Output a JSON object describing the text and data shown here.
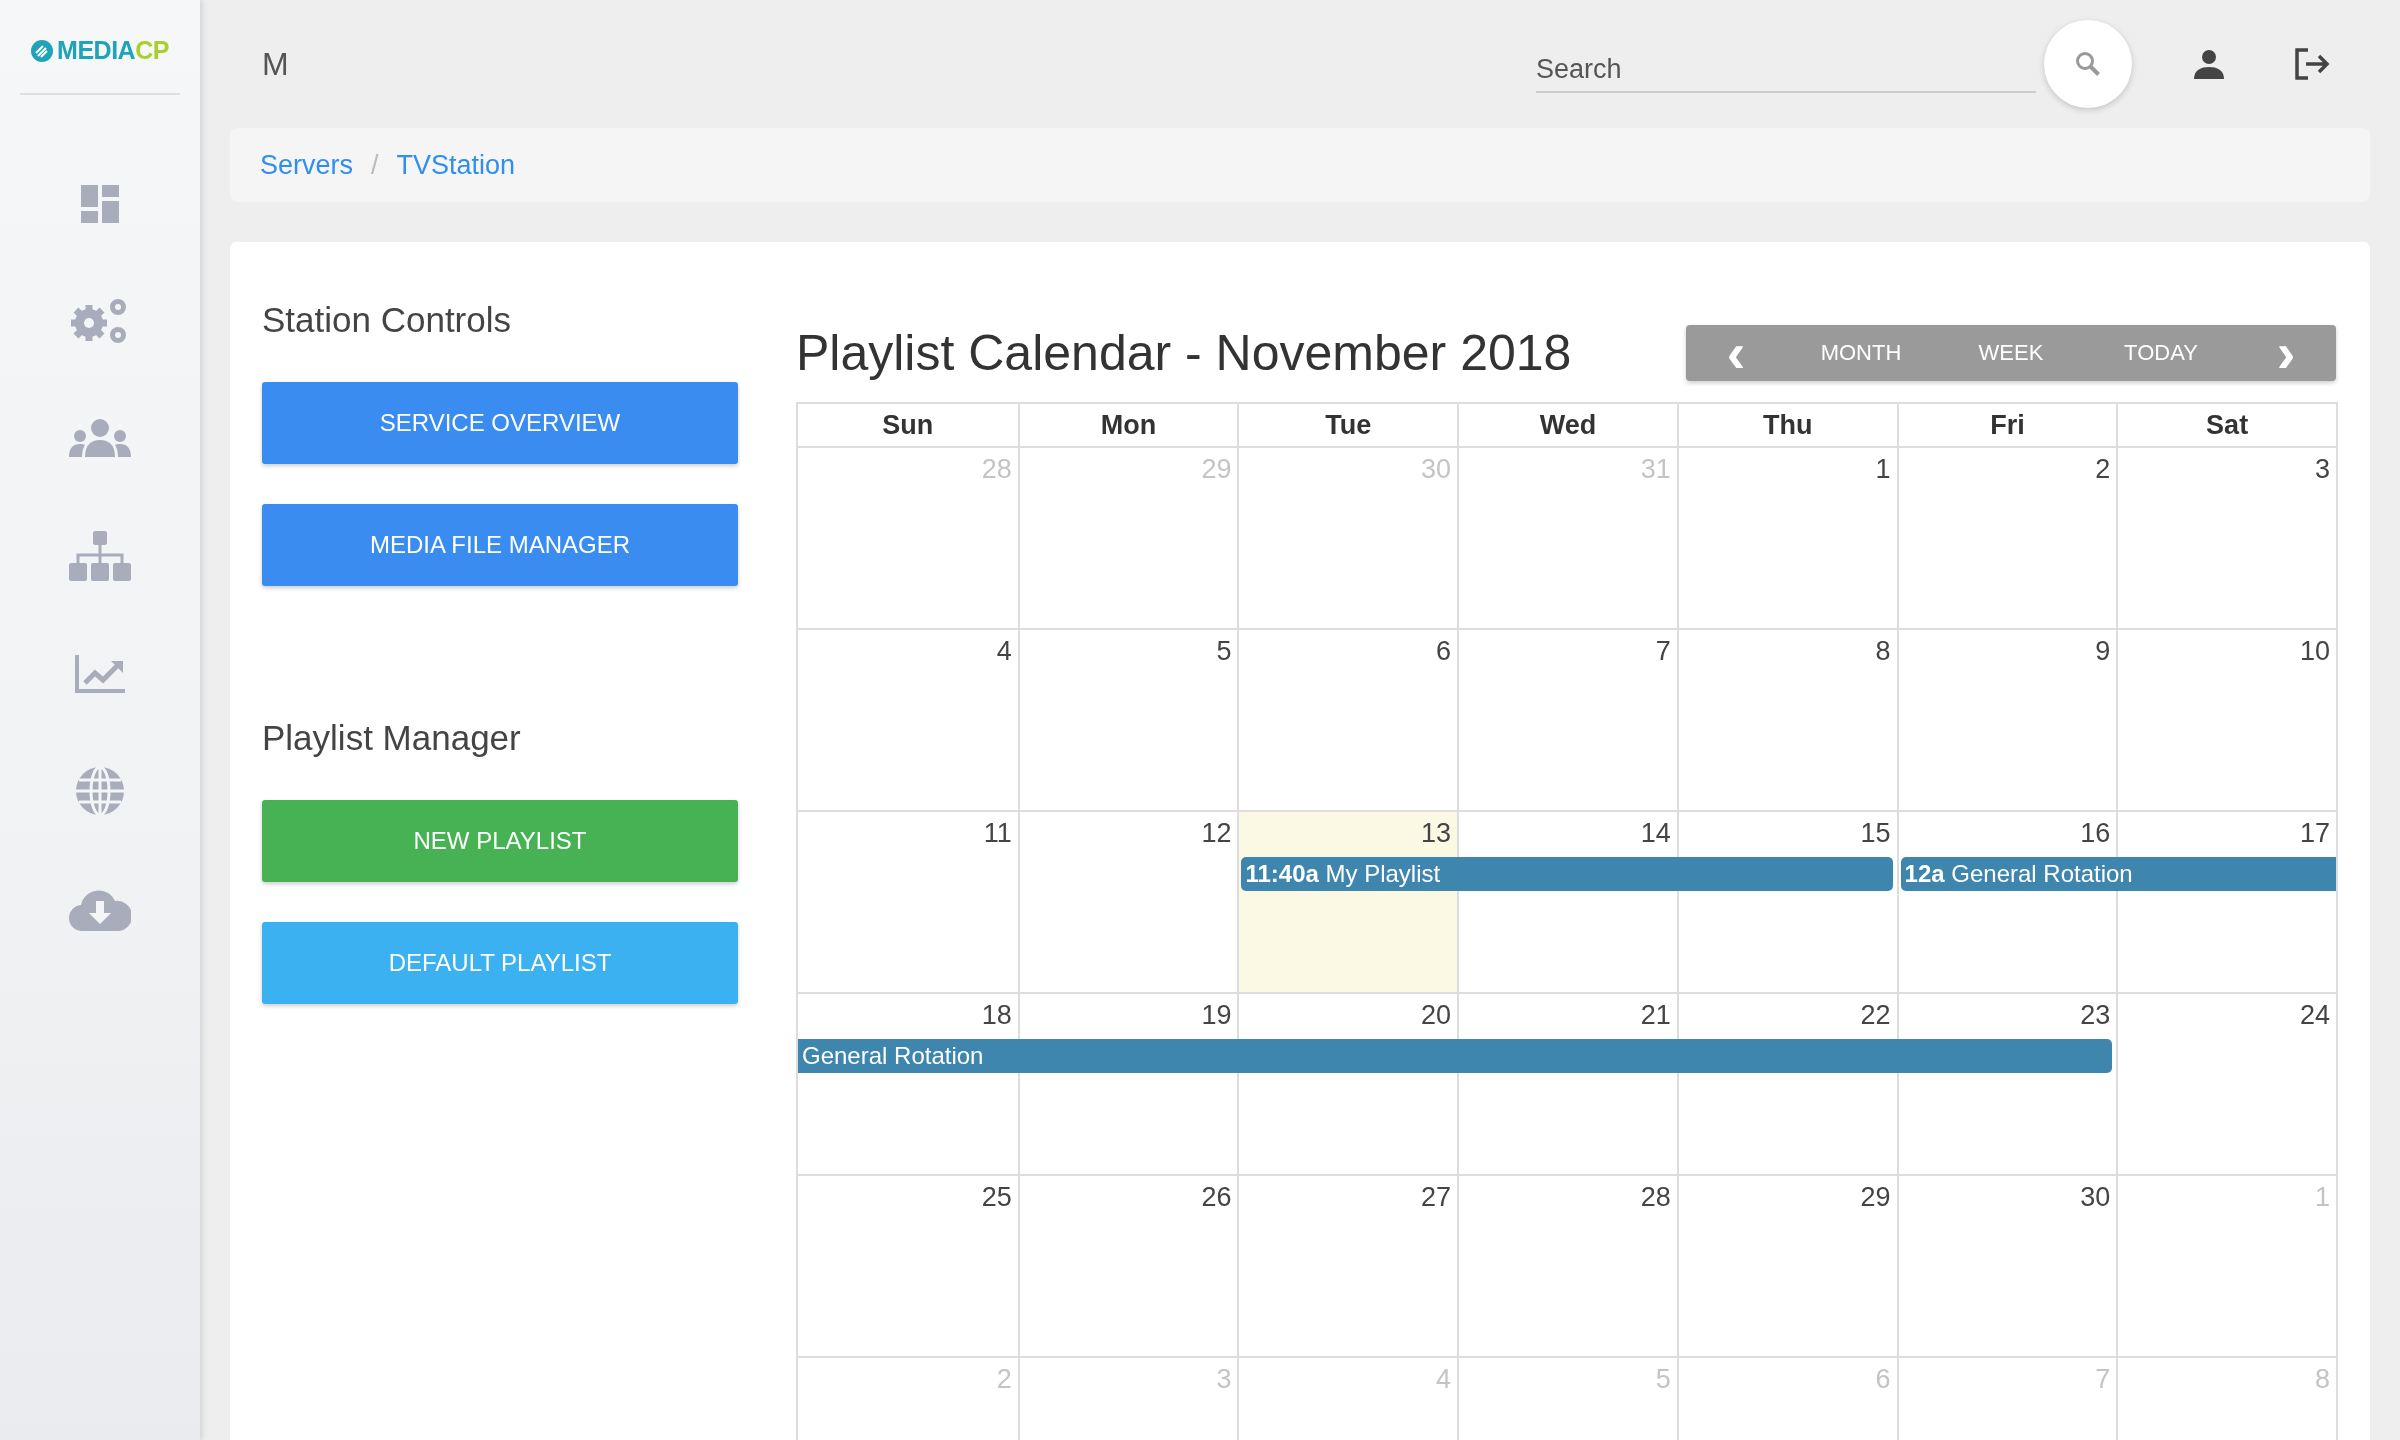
{
  "sidebar": {
    "brand": "MEDIA",
    "brand_accent": "CP"
  },
  "top_bar": {
    "title": "M",
    "search": {
      "placeholder": "Search"
    }
  },
  "breadcrumb": {
    "items": [
      "Servers",
      "TVStation"
    ],
    "separator": "/"
  },
  "panels": [
    {
      "title": "Station Controls",
      "buttons": [
        {
          "label": "SERVICE OVERVIEW",
          "kind": "primary"
        },
        {
          "label": "MEDIA FILE MANAGER",
          "kind": "primary"
        }
      ]
    },
    {
      "title": "Playlist Manager",
      "buttons": [
        {
          "label": "NEW PLAYLIST",
          "kind": "success"
        },
        {
          "label": "DEFAULT PLAYLIST",
          "kind": "info"
        }
      ]
    }
  ],
  "calendar": {
    "title": "Playlist Calendar - November 2018",
    "nav": {
      "prev": "‹",
      "next": "›",
      "buttons": [
        "MONTH",
        "WEEK",
        "TODAY"
      ]
    },
    "weekdays": [
      "Sun",
      "Mon",
      "Tue",
      "Wed",
      "Thu",
      "Fri",
      "Sat"
    ],
    "weeks": [
      {
        "days": [
          {
            "day": "28",
            "other_month": true,
            "today": false
          },
          {
            "day": "29",
            "other_month": true,
            "today": false
          },
          {
            "day": "30",
            "other_month": true,
            "today": false
          },
          {
            "day": "31",
            "other_month": true,
            "today": false
          },
          {
            "day": "1",
            "other_month": false,
            "today": false
          },
          {
            "day": "2",
            "other_month": false,
            "today": false
          },
          {
            "day": "3",
            "other_month": false,
            "today": false
          }
        ]
      },
      {
        "days": [
          {
            "day": "4",
            "other_month": false,
            "today": false
          },
          {
            "day": "5",
            "other_month": false,
            "today": false
          },
          {
            "day": "6",
            "other_month": false,
            "today": false
          },
          {
            "day": "7",
            "other_month": false,
            "today": false
          },
          {
            "day": "8",
            "other_month": false,
            "today": false
          },
          {
            "day": "9",
            "other_month": false,
            "today": false
          },
          {
            "day": "10",
            "other_month": false,
            "today": false
          }
        ]
      },
      {
        "days": [
          {
            "day": "11",
            "other_month": false,
            "today": false
          },
          {
            "day": "12",
            "other_month": false,
            "today": false
          },
          {
            "day": "13",
            "other_month": false,
            "today": true,
            "has_event": true,
            "event": {
              "time": "11:40a",
              "title": "My Playlist",
              "continues_before": false,
              "continues_after": false
            }
          },
          {
            "day": "14",
            "other_month": false,
            "today": false,
            "has_event": true
          },
          {
            "day": "15",
            "other_month": false,
            "today": false,
            "has_event": true
          },
          {
            "day": "16",
            "other_month": false,
            "today": false,
            "has_event": true,
            "event": {
              "time": "12a",
              "title": "General Rotation",
              "continues_before": false,
              "continues_after": true
            }
          },
          {
            "day": "17",
            "other_month": false,
            "today": false,
            "has_event": true
          }
        ]
      },
      {
        "days": [
          {
            "day": "18",
            "other_month": false,
            "today": false,
            "has_event": true,
            "event": {
              "title": "General Rotation",
              "continues_before": true,
              "continues_after": false
            }
          },
          {
            "day": "19",
            "other_month": false,
            "today": false,
            "has_event": true
          },
          {
            "day": "20",
            "other_month": false,
            "today": false,
            "has_event": true
          },
          {
            "day": "21",
            "other_month": false,
            "today": false,
            "has_event": true
          },
          {
            "day": "22",
            "other_month": false,
            "today": false,
            "has_event": true
          },
          {
            "day": "23",
            "other_month": false,
            "today": false,
            "has_event": true
          },
          {
            "day": "24",
            "other_month": false,
            "today": false
          }
        ]
      },
      {
        "days": [
          {
            "day": "25",
            "other_month": false,
            "today": false
          },
          {
            "day": "26",
            "other_month": false,
            "today": false
          },
          {
            "day": "27",
            "other_month": false,
            "today": false
          },
          {
            "day": "28",
            "other_month": false,
            "today": false
          },
          {
            "day": "29",
            "other_month": false,
            "today": false
          },
          {
            "day": "30",
            "other_month": false,
            "today": false
          },
          {
            "day": "1",
            "other_month": true,
            "today": false
          }
        ]
      },
      {
        "days": [
          {
            "day": "2",
            "other_month": true,
            "today": false
          },
          {
            "day": "3",
            "other_month": true,
            "today": false
          },
          {
            "day": "4",
            "other_month": true,
            "today": false
          },
          {
            "day": "5",
            "other_month": true,
            "today": false
          },
          {
            "day": "6",
            "other_month": true,
            "today": false
          },
          {
            "day": "7",
            "other_month": true,
            "today": false
          },
          {
            "day": "8",
            "other_month": true,
            "today": false
          }
        ]
      }
    ]
  }
}
